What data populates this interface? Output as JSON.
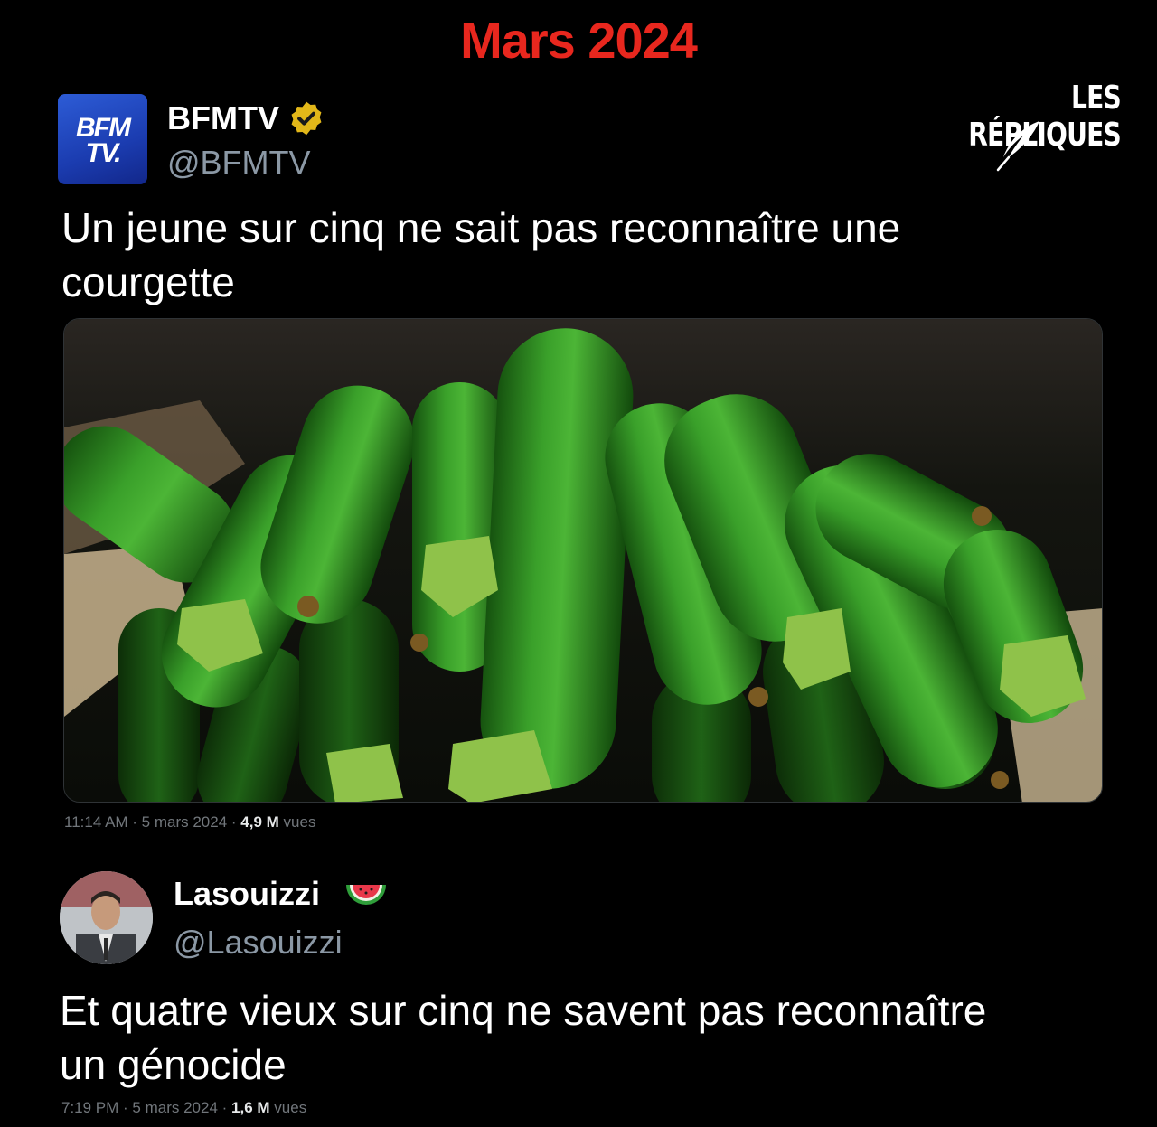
{
  "header": {
    "title": "Mars 2024"
  },
  "brand": {
    "name": "LES RÉPLIQUES",
    "logo_icon": "feather-icon"
  },
  "tweet1": {
    "avatar_text_line1": "BFM",
    "avatar_text_line2": "TV.",
    "display_name": "BFMTV",
    "badge_icon": "verified-gold-badge-icon",
    "handle": "@BFMTV",
    "text_line1": "Un jeune sur cinq ne sait pas reconnaître une",
    "text_line2": "courgette",
    "media_description_icon": "zucchini-photo",
    "meta_time": "11:14 AM · 5 mars 2024 · ",
    "meta_views": "4,9 M",
    "meta_views_suffix": " vues"
  },
  "tweet2": {
    "display_name": "Lasouizzi",
    "badge_icon": "watermelon-icon",
    "handle": "@Lasouizzi",
    "text_line1": "Et quatre vieux sur cinq ne savent pas reconnaître",
    "text_line2": "un génocide",
    "meta_time": "7:19 PM · 5 mars 2024 · ",
    "meta_views": "1,6 M",
    "meta_views_suffix": " vues"
  },
  "colors": {
    "background": "#000000",
    "title_red": "#e8271e",
    "bfm_blue": "#1b3cb0",
    "verified_gold": "#e2b719",
    "handle_gray": "#8b98a5",
    "zucchini_green": "#2e8a1f"
  }
}
